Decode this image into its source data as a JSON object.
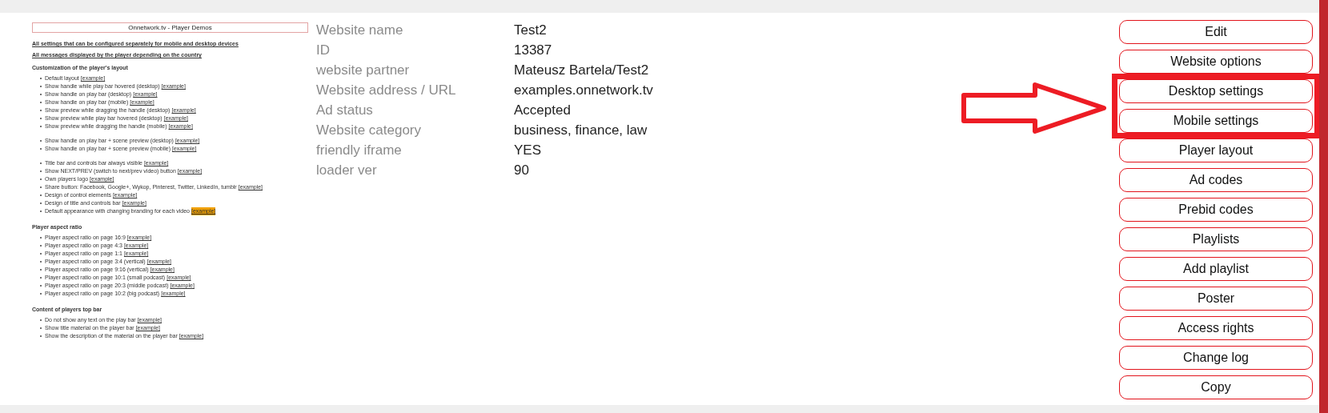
{
  "preview": {
    "title": "Onnetwork.tv - Player Demos",
    "links": [
      "All settings that can be configured separately for mobile and desktop devices",
      "All messages displayed by the player depending on the country"
    ],
    "sections": [
      {
        "heading": "Customization of the player's layout",
        "groups": [
          [
            {
              "text": "Default layout",
              "link": "[example]",
              "highlighted": false
            },
            {
              "text": "Show handle while play bar hovered (desktop)",
              "link": "[example]",
              "highlighted": false
            },
            {
              "text": "Show handle on play bar (desktop)",
              "link": "[example]",
              "highlighted": false
            },
            {
              "text": "Show handle on play bar (mobile)",
              "link": "[example]",
              "highlighted": false
            },
            {
              "text": "Show preview while dragging the handle (desktop)",
              "link": "[example]",
              "highlighted": false
            },
            {
              "text": "Show preview while play bar hovered (desktop)",
              "link": "[example]",
              "highlighted": false
            },
            {
              "text": "Show preview while dragging the handle (mobile)",
              "link": "[example]",
              "highlighted": false
            }
          ],
          [
            {
              "text": "Show handle on play bar + scene preview (desktop)",
              "link": "[example]",
              "highlighted": false
            },
            {
              "text": "Show handle on play bar + scene preview (mobile)",
              "link": "[example]",
              "highlighted": false
            }
          ],
          [
            {
              "text": "Title bar and controls bar always visible",
              "link": "[example]",
              "highlighted": false
            },
            {
              "text": "Show NEXT/PREV (switch to next/prev video) button",
              "link": "[example]",
              "highlighted": false
            },
            {
              "text": "Own players logo",
              "link": "[example]",
              "highlighted": false
            },
            {
              "text": "Share button: Facebook, Google+, Wykop, Pinterest, Twitter, LinkedIn, tumblr",
              "link": "[example]",
              "highlighted": false
            },
            {
              "text": "Design of control elements",
              "link": "[example]",
              "highlighted": false
            },
            {
              "text": "Design of title and controls bar",
              "link": "[example]",
              "highlighted": false
            },
            {
              "text": "Default appearance with changing branding for each video",
              "link": "[example]",
              "highlighted": true
            }
          ]
        ]
      },
      {
        "heading": "Player aspect ratio",
        "groups": [
          [
            {
              "text": "Player aspect ratio on page 16:9",
              "link": "[example]",
              "highlighted": false
            },
            {
              "text": "Player aspect ratio on page 4:3",
              "link": "[example]",
              "highlighted": false
            },
            {
              "text": "Player aspect ratio on page 1:1",
              "link": "[example]",
              "highlighted": false
            },
            {
              "text": "Player aspect ratio on page 3:4 (vertical)",
              "link": "[example]",
              "highlighted": false
            },
            {
              "text": "Player aspect ratio on page 9:16 (vertical)",
              "link": "[example]",
              "highlighted": false
            },
            {
              "text": "Player aspect ratio on page 10:1 (small podcast)",
              "link": "[example]",
              "highlighted": false
            },
            {
              "text": "Player aspect ratio on page 20:3 (middle podcast)",
              "link": "[example]",
              "highlighted": false
            },
            {
              "text": "Player aspect ratio on page 10:2 (big podcast)",
              "link": "[example]",
              "highlighted": false
            }
          ]
        ]
      },
      {
        "heading": "Content of players top bar",
        "groups": [
          [
            {
              "text": "Do not show any text on the play bar",
              "link": "[example]",
              "highlighted": false
            },
            {
              "text": "Show title material on the player bar",
              "link": "[example]",
              "highlighted": false
            },
            {
              "text": "Show the description of the material on the player bar",
              "link": "[example]",
              "highlighted": false
            }
          ]
        ]
      }
    ]
  },
  "details": [
    {
      "label": "Website name",
      "value": "Test2"
    },
    {
      "label": "ID",
      "value": "13387"
    },
    {
      "label": "website partner",
      "value": "Mateusz Bartela/Test2"
    },
    {
      "label": "Website address / URL",
      "value": "examples.onnetwork.tv"
    },
    {
      "label": "Ad status",
      "value": "Accepted"
    },
    {
      "label": "Website category",
      "value": "business, finance, law"
    },
    {
      "label": "friendly iframe",
      "value": "YES"
    },
    {
      "label": "loader ver",
      "value": "90"
    }
  ],
  "buttons": [
    {
      "label": "Edit",
      "highlighted": false
    },
    {
      "label": "Website options",
      "highlighted": false
    },
    {
      "label": "Desktop settings",
      "highlighted": true
    },
    {
      "label": "Mobile settings",
      "highlighted": true
    },
    {
      "label": "Player layout",
      "highlighted": false
    },
    {
      "label": "Ad codes",
      "highlighted": false
    },
    {
      "label": "Prebid codes",
      "highlighted": false
    },
    {
      "label": "Playlists",
      "highlighted": false
    },
    {
      "label": "Add playlist",
      "highlighted": false
    },
    {
      "label": "Poster",
      "highlighted": false
    },
    {
      "label": "Access rights",
      "highlighted": false
    },
    {
      "label": "Change log",
      "highlighted": false
    },
    {
      "label": "Copy",
      "highlighted": false
    }
  ]
}
